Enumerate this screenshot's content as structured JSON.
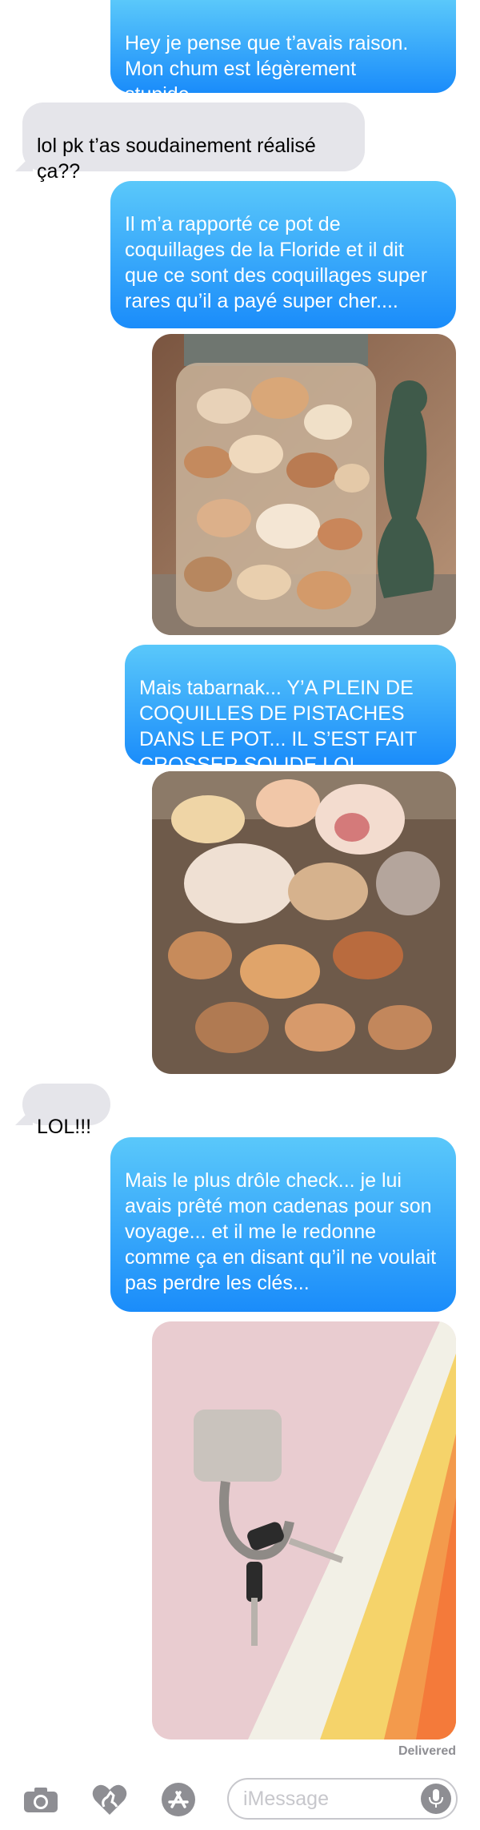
{
  "messages": [
    {
      "kind": "sent",
      "text": "Hey je pense que t’avais raison. Mon chum est légèrement stupide..."
    },
    {
      "kind": "received",
      "text": "lol pk t’as soudainement réalisé ça??"
    },
    {
      "kind": "sent",
      "text": "Il m’a rapporté ce pot de coquillages de la Floride et il dit que ce sont des coquillages super rares qu’il a payé super cher...."
    },
    {
      "kind": "image",
      "subject": "jar of seashells next to mermaid statue"
    },
    {
      "kind": "sent",
      "text": "Mais tabarnak... Y’A PLEIN DE COQUILLES DE PISTACHES DANS LE POT... IL S’EST FAIT CROSSER SOLIDE LOL"
    },
    {
      "kind": "image",
      "subject": "close-up of seashells with pistachio shells"
    },
    {
      "kind": "received",
      "text": "LOL!!!"
    },
    {
      "kind": "sent",
      "text": "Mais le plus drôle check... je lui avais prêté mon cadenas pour son voyage... et il me le redonne comme ça en disant qu’il ne voulait pas perdre les clés..."
    },
    {
      "kind": "image",
      "subject": "padlock with keys on striped fabric"
    }
  ],
  "status": "Delivered",
  "input": {
    "placeholder": "iMessage",
    "icons": {
      "camera": "camera-icon",
      "digital_touch": "heart-hand-icon",
      "app_store": "app-store-icon",
      "mic": "microphone-icon"
    }
  },
  "colors": {
    "sent_bubble_top": "#5ac8fa",
    "sent_bubble_bottom": "#1a8cfa",
    "received_bubble": "#e5e5ea",
    "status_text": "#8e8e93"
  }
}
